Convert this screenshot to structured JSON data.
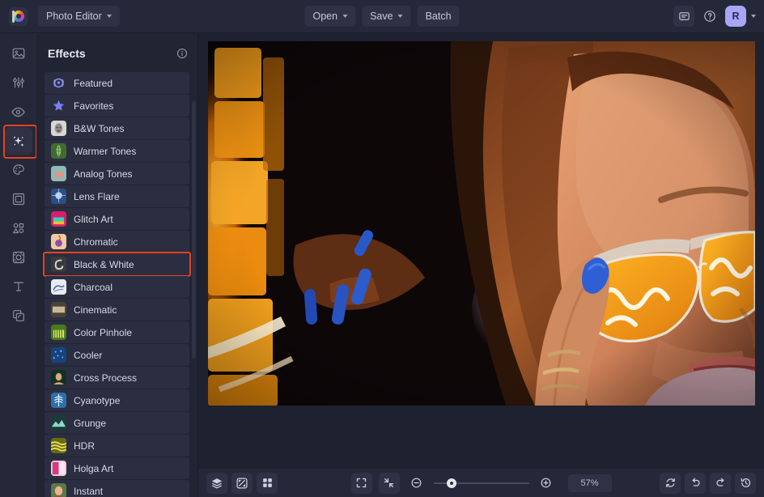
{
  "app": {
    "logo_icon": "photo-editor-logo",
    "switcher_label": "Photo Editor"
  },
  "topbar": {
    "open_label": "Open",
    "save_label": "Save",
    "batch_label": "Batch",
    "feedback_icon": "chat-bubble-icon",
    "help_icon": "help-circle-icon",
    "avatar_initial": "R"
  },
  "rail": {
    "items": [
      {
        "name": "sidebar-item-image",
        "icon": "image-icon",
        "active": false
      },
      {
        "name": "sidebar-item-adjust",
        "icon": "sliders-icon",
        "active": false
      },
      {
        "name": "sidebar-item-retouch",
        "icon": "eye-icon",
        "active": false
      },
      {
        "name": "sidebar-item-effects",
        "icon": "sparkles-icon",
        "active": true
      },
      {
        "name": "sidebar-item-paint",
        "icon": "palette-icon",
        "active": false
      },
      {
        "name": "sidebar-item-frames",
        "icon": "frame-icon",
        "active": false
      },
      {
        "name": "sidebar-item-shapes",
        "icon": "shapes-icon",
        "active": false
      },
      {
        "name": "sidebar-item-overlays",
        "icon": "overlay-icon",
        "active": false
      },
      {
        "name": "sidebar-item-text",
        "icon": "text-icon",
        "active": false
      },
      {
        "name": "sidebar-item-layers",
        "icon": "duplicate-icon",
        "active": false
      }
    ]
  },
  "panel": {
    "title": "Effects",
    "info_icon": "info-circle-icon",
    "items": [
      {
        "label": "Featured",
        "thumb": "laurel-icon",
        "selected": false
      },
      {
        "label": "Favorites",
        "thumb": "star-icon",
        "selected": false
      },
      {
        "label": "B&W Tones",
        "thumb": "bw-face",
        "selected": false
      },
      {
        "label": "Warmer Tones",
        "thumb": "green-leaf",
        "selected": false
      },
      {
        "label": "Analog Tones",
        "thumb": "flamingo",
        "selected": false
      },
      {
        "label": "Lens Flare",
        "thumb": "blue-flare",
        "selected": false
      },
      {
        "label": "Glitch Art",
        "thumb": "glitch-face",
        "selected": false
      },
      {
        "label": "Chromatic",
        "thumb": "chromatic-orb",
        "selected": false
      },
      {
        "label": "Black & White",
        "thumb": "bw-swirl",
        "selected": true
      },
      {
        "label": "Charcoal",
        "thumb": "charcoal",
        "selected": false
      },
      {
        "label": "Cinematic",
        "thumb": "film-strip",
        "selected": false
      },
      {
        "label": "Color Pinhole",
        "thumb": "green-gate",
        "selected": false
      },
      {
        "label": "Cooler",
        "thumb": "blue-sparkle",
        "selected": false
      },
      {
        "label": "Cross Process",
        "thumb": "portrait-dark",
        "selected": false
      },
      {
        "label": "Cyanotype",
        "thumb": "cyan-fern",
        "selected": false
      },
      {
        "label": "Grunge",
        "thumb": "teal-ridge",
        "selected": false
      },
      {
        "label": "HDR",
        "thumb": "yellow-field",
        "selected": false
      },
      {
        "label": "Holga Art",
        "thumb": "pink-holga",
        "selected": false
      },
      {
        "label": "Instant",
        "thumb": "instant-face",
        "selected": false
      }
    ]
  },
  "canvas": {
    "image_alt": "neon-portrait-woman-sunglasses"
  },
  "bottombar": {
    "layers_icon": "layers-icon",
    "compare_icon": "compare-icon",
    "grid_icon": "grid-icon",
    "fit_icon": "fit-screen-icon",
    "collapse_icon": "collapse-icon",
    "zoom_out_icon": "zoom-out-icon",
    "zoom_in_icon": "zoom-in-icon",
    "zoom_value": "57%",
    "reset_icon": "reset-icon",
    "undo_icon": "undo-icon",
    "redo_icon": "redo-icon",
    "history_icon": "history-icon"
  },
  "colors": {
    "accent_highlight": "#e8411f",
    "avatar_bg": "#a8a6f5",
    "panel_bg": "#212433",
    "topbar_bg": "#252838",
    "canvas_bg": "#1e2130"
  }
}
